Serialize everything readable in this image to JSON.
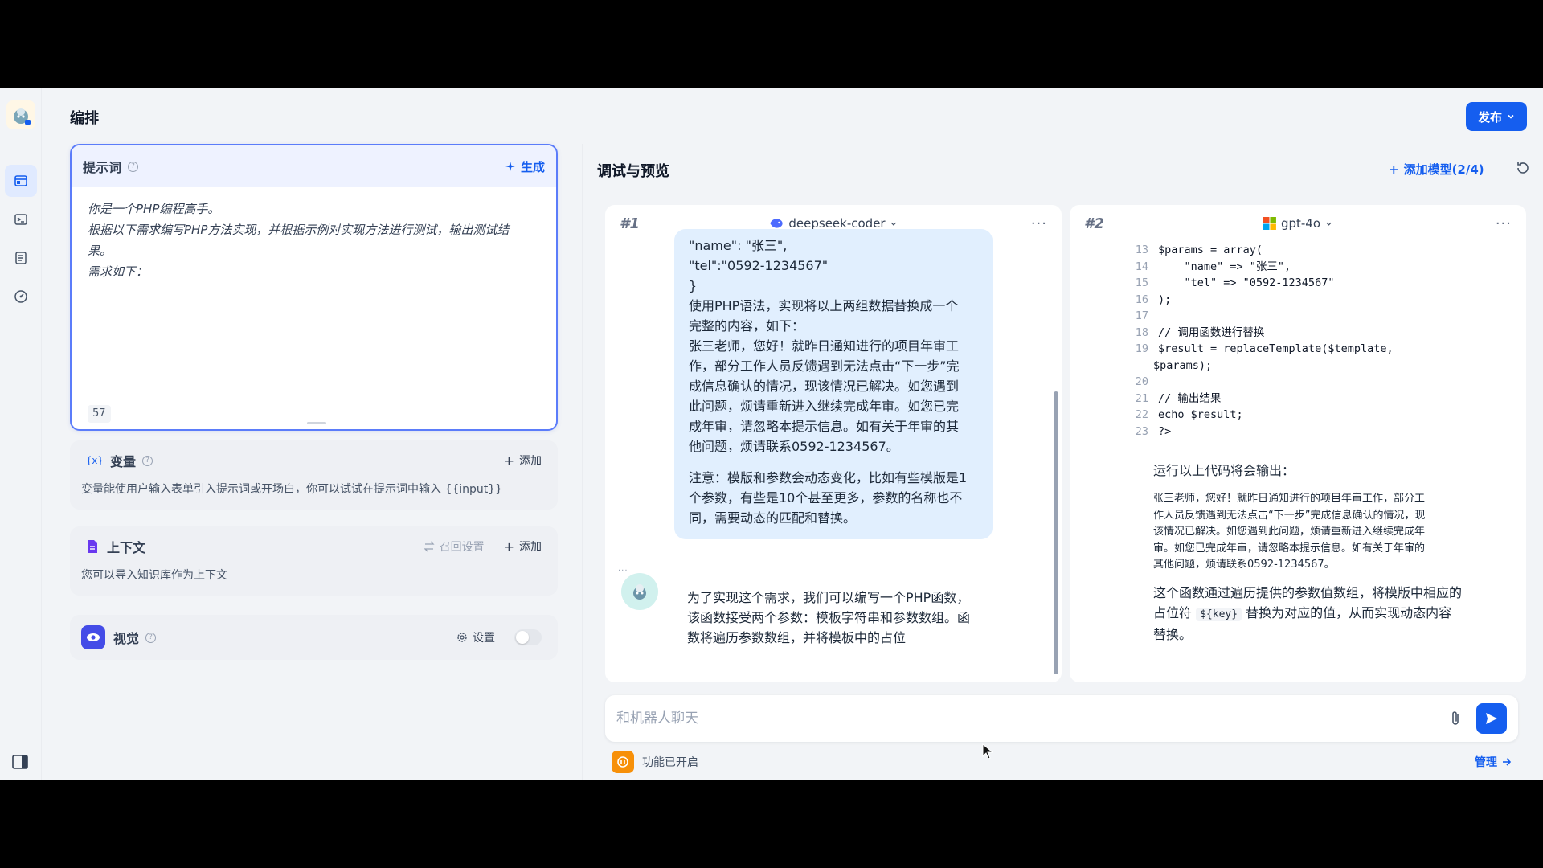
{
  "header": {
    "title": "编排",
    "publish_label": "发布"
  },
  "prompt": {
    "label": "提示词",
    "generate_label": "生成",
    "lines": [
      "你是一个PHP编程高手。",
      "根据以下需求编写PHP方法实现，并根据示例对实现方法进行测试，输出测试结",
      "果。",
      "需求如下："
    ],
    "char_count": "57"
  },
  "variables": {
    "title": "变量",
    "add_label": "添加",
    "description": "变量能使用户输入表单引入提示词或开场白，你可以试试在提示词中输入 {{input}}"
  },
  "context": {
    "title": "上下文",
    "recall_label": "召回设置",
    "add_label": "添加",
    "description": "您可以导入知识库作为上下文"
  },
  "vision": {
    "title": "视觉",
    "settings_label": "设置",
    "enabled": false
  },
  "debug": {
    "title": "调试与预览",
    "add_model_label": "添加模型(2/4)",
    "models": [
      {
        "num": "#1",
        "name": "deepseek-coder",
        "user_message": [
          "\"name\": \"张三\",",
          "\"tel\":\"0592-1234567\"",
          "}",
          "使用PHP语法，实现将以上两组数据替换成一个",
          "完整的内容，如下：",
          "张三老师，您好！就昨日通知进行的项目年审工",
          "作，部分工作人员反馈遇到无法点击“下一步”完",
          "成信息确认的情况，现该情况已解决。如您遇到",
          "此问题，烦请重新进入继续完成年审。如您已完",
          "成年审，请忽略本提示信息。如有关于年审的其",
          "他问题，烦请联系0592-1234567。"
        ],
        "user_note": [
          "注意：模版和参数会动态变化，比如有些模版是1",
          "个参数，有些是10个甚至更多，参数的名称也不",
          "同，需要动态的匹配和替换。"
        ],
        "bot_reply": [
          "为了实现这个需求，我们可以编写一个PHP函数，",
          "该函数接受两个参数：模板字符串和参数数组。函",
          "数将遍历参数数组，并将模板中的占位"
        ]
      },
      {
        "num": "#2",
        "name": "gpt-4o",
        "code_lines": [
          {
            "ln": "13",
            "text": "$params = array("
          },
          {
            "ln": "14",
            "text": "    \"name\" => \"张三\","
          },
          {
            "ln": "15",
            "text": "    \"tel\" => \"0592-1234567\""
          },
          {
            "ln": "16",
            "text": ");"
          },
          {
            "ln": "17",
            "text": ""
          },
          {
            "ln": "18",
            "text": "// 调用函数进行替换"
          },
          {
            "ln": "19",
            "text": "$result = replaceTemplate($template,"
          },
          {
            "ln": "",
            "text": "$params);"
          },
          {
            "ln": "20",
            "text": ""
          },
          {
            "ln": "21",
            "text": "// 输出结果"
          },
          {
            "ln": "22",
            "text": "echo $result;"
          },
          {
            "ln": "23",
            "text": "?>"
          }
        ],
        "output_label": "运行以上代码将会输出：",
        "output_lines": [
          "张三老师，您好！就昨日通知进行的项目年审工作，部分工",
          "作人员反馈遇到无法点击“下一步”完成信息确认的情况，现",
          "该情况已解决。如您遇到此问题，烦请重新进入继续完成年",
          "审。如您已完成年审，请忽略本提示信息。如有关于年审的",
          "其他问题，烦请联系0592-1234567。"
        ],
        "final_before": "这个函数通过遍历提供的参数值数组，将模版中相应的占位符",
        "final_code": "${key}",
        "final_after": "替换为对应的值，从而实现动态内容替换。"
      }
    ],
    "chat_placeholder": "和机器人聊天",
    "feature_label": "功能已开启",
    "manage_label": "管理"
  },
  "colors": {
    "accent": "#155eef",
    "bubble": "#e1effe",
    "feature": "#f79009"
  }
}
